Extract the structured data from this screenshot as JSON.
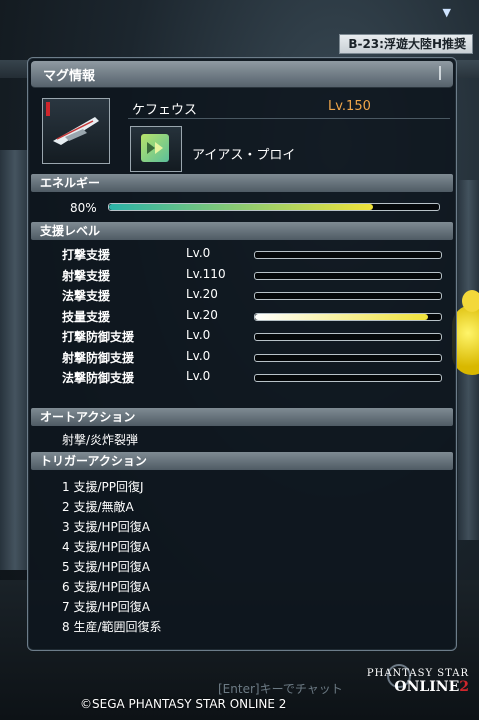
{
  "location": "B-23:浮遊大陸H推奨",
  "panel": {
    "title": "マグ情報",
    "mag_name": "ケフェウス",
    "mag_level": "Lv.150",
    "photon_blast": "アイアス・プロイ"
  },
  "energy": {
    "header": "エネルギー",
    "percent_label": "80%",
    "percent": 80
  },
  "support": {
    "header": "支援レベル",
    "rows": [
      {
        "name": "打撃支援",
        "level": "Lv.0",
        "fill": 0
      },
      {
        "name": "射撃支援",
        "level": "Lv.110",
        "fill": 0
      },
      {
        "name": "法撃支援",
        "level": "Lv.20",
        "fill": 0
      },
      {
        "name": "技量支援",
        "level": "Lv.20",
        "fill": 0.93
      },
      {
        "name": "打撃防御支援",
        "level": "Lv.0",
        "fill": 0
      },
      {
        "name": "射撃防御支援",
        "level": "Lv.0",
        "fill": 0
      },
      {
        "name": "法撃防御支援",
        "level": "Lv.0",
        "fill": 0
      }
    ]
  },
  "auto_action": {
    "header": "オートアクション",
    "value": "射撃/炎炸裂弾"
  },
  "trigger_action": {
    "header": "トリガーアクション",
    "items": [
      "1 支援/PP回復J",
      "2 支援/無敵A",
      "3 支援/HP回復A",
      "4 支援/HP回復A",
      "5 支援/HP回復A",
      "6 支援/HP回復A",
      "7 支援/HP回復A",
      "8 生産/範囲回復系"
    ]
  },
  "footer": {
    "chat_hint": "[Enter]キーでチャット",
    "copyright": "©SEGA PHANTASY STAR ONLINE 2",
    "logo_line1": "PHANTASY STAR",
    "logo_line2": "ONLINE",
    "logo_num": "2"
  },
  "colors": {
    "energy_fill_start": "#2bb3a8",
    "energy_fill_end": "#f0e23a",
    "support_fill": "#f0e23a",
    "level_text": "#f0a64a"
  },
  "icons": {
    "mag": "mag-icon",
    "photon_blast": "photon-blast-icon"
  }
}
